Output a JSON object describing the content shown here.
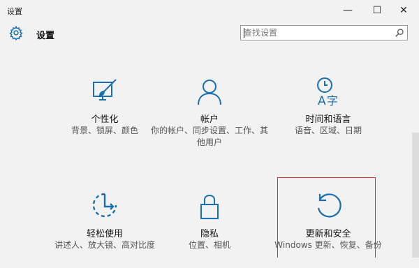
{
  "window": {
    "title": "设置",
    "minimize_glyph": "—",
    "maximize_glyph": "☐",
    "close_glyph": "✕"
  },
  "header": {
    "title": "设置",
    "icon": "gear-icon"
  },
  "search": {
    "placeholder": "查找设置",
    "value": "",
    "icon": "search-icon"
  },
  "tiles": [
    {
      "title": "个性化",
      "desc": "背景、锁屏、颜色",
      "icon": "personalization-icon"
    },
    {
      "title": "帐户",
      "desc": "你的帐户、同步设置、工作、其他用户",
      "icon": "account-icon"
    },
    {
      "title": "时间和语言",
      "desc": "语音、区域、日期",
      "icon": "time-language-icon"
    },
    {
      "title": "轻松使用",
      "desc": "讲述人、放大镜、高对比度",
      "icon": "ease-of-access-icon"
    },
    {
      "title": "隐私",
      "desc": "位置、相机",
      "icon": "privacy-lock-icon"
    },
    {
      "title": "更新和安全",
      "desc": "Windows 更新、恢复、备份",
      "icon": "update-icon"
    }
  ],
  "colors": {
    "accent": "#1a6fb0",
    "highlight_border": "#d83030",
    "background": "#f2f2f2"
  }
}
